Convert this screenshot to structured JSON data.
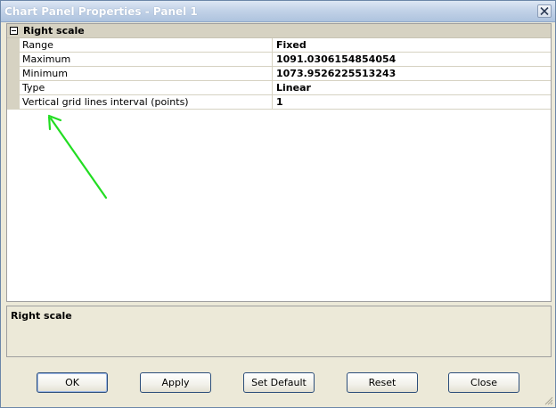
{
  "window": {
    "title": "Chart Panel Properties - Panel 1"
  },
  "property_grid": {
    "category": "Right scale",
    "rows": [
      {
        "name": "Range",
        "value": "Fixed"
      },
      {
        "name": "Maximum",
        "value": "1091.0306154854054"
      },
      {
        "name": "Minimum",
        "value": "1073.9526225513243"
      },
      {
        "name": "Type",
        "value": "Linear"
      },
      {
        "name": "Vertical grid lines interval (points)",
        "value": "1"
      }
    ]
  },
  "description": {
    "title": "Right scale"
  },
  "buttons": {
    "ok": "OK",
    "apply": "Apply",
    "set_default": "Set Default",
    "reset": "Reset",
    "close": "Close"
  },
  "colors": {
    "annotation_arrow": "#22dd22",
    "category_bg": "#d6d2c2",
    "dialog_bg": "#ece9d8"
  },
  "icons": {
    "close": "close-icon",
    "collapse": "minus-box-icon",
    "resize": "resize-grip-icon"
  }
}
